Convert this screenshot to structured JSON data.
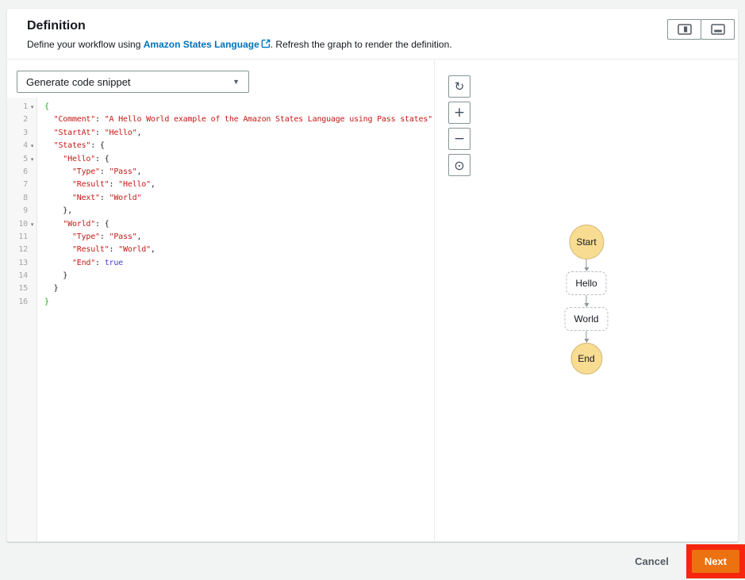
{
  "header": {
    "title": "Definition",
    "subtitle_prefix": "Define your workflow using ",
    "link_text": "Amazon States Language",
    "subtitle_suffix": ". Refresh the graph to render the definition."
  },
  "toolbar": {
    "snippet_dropdown_label": "Generate code snippet"
  },
  "editor": {
    "lines": [
      {
        "n": "1",
        "fold": true,
        "seg": [
          {
            "t": "{",
            "c": "green"
          }
        ]
      },
      {
        "n": "2",
        "fold": false,
        "seg": [
          {
            "t": "  ",
            "c": "pln"
          },
          {
            "t": "\"Comment\"",
            "c": "str"
          },
          {
            "t": ": ",
            "c": "pln"
          },
          {
            "t": "\"A Hello World example of the Amazon States Language using Pass states\"",
            "c": "str"
          },
          {
            "t": ",",
            "c": "pln"
          }
        ]
      },
      {
        "n": "3",
        "fold": false,
        "seg": [
          {
            "t": "  ",
            "c": "pln"
          },
          {
            "t": "\"StartAt\"",
            "c": "str"
          },
          {
            "t": ": ",
            "c": "pln"
          },
          {
            "t": "\"Hello\"",
            "c": "str"
          },
          {
            "t": ",",
            "c": "pln"
          }
        ]
      },
      {
        "n": "4",
        "fold": true,
        "seg": [
          {
            "t": "  ",
            "c": "pln"
          },
          {
            "t": "\"States\"",
            "c": "str"
          },
          {
            "t": ": {",
            "c": "pln"
          }
        ]
      },
      {
        "n": "5",
        "fold": true,
        "seg": [
          {
            "t": "    ",
            "c": "pln"
          },
          {
            "t": "\"Hello\"",
            "c": "str"
          },
          {
            "t": ": {",
            "c": "pln"
          }
        ]
      },
      {
        "n": "6",
        "fold": false,
        "seg": [
          {
            "t": "      ",
            "c": "pln"
          },
          {
            "t": "\"Type\"",
            "c": "str"
          },
          {
            "t": ": ",
            "c": "pln"
          },
          {
            "t": "\"Pass\"",
            "c": "str"
          },
          {
            "t": ",",
            "c": "pln"
          }
        ]
      },
      {
        "n": "7",
        "fold": false,
        "seg": [
          {
            "t": "      ",
            "c": "pln"
          },
          {
            "t": "\"Result\"",
            "c": "str"
          },
          {
            "t": ": ",
            "c": "pln"
          },
          {
            "t": "\"Hello\"",
            "c": "str"
          },
          {
            "t": ",",
            "c": "pln"
          }
        ]
      },
      {
        "n": "8",
        "fold": false,
        "seg": [
          {
            "t": "      ",
            "c": "pln"
          },
          {
            "t": "\"Next\"",
            "c": "str"
          },
          {
            "t": ": ",
            "c": "pln"
          },
          {
            "t": "\"World\"",
            "c": "str"
          }
        ]
      },
      {
        "n": "9",
        "fold": false,
        "seg": [
          {
            "t": "    },",
            "c": "pln"
          }
        ]
      },
      {
        "n": "10",
        "fold": true,
        "seg": [
          {
            "t": "    ",
            "c": "pln"
          },
          {
            "t": "\"World\"",
            "c": "str"
          },
          {
            "t": ": {",
            "c": "pln"
          }
        ]
      },
      {
        "n": "11",
        "fold": false,
        "seg": [
          {
            "t": "      ",
            "c": "pln"
          },
          {
            "t": "\"Type\"",
            "c": "str"
          },
          {
            "t": ": ",
            "c": "pln"
          },
          {
            "t": "\"Pass\"",
            "c": "str"
          },
          {
            "t": ",",
            "c": "pln"
          }
        ]
      },
      {
        "n": "12",
        "fold": false,
        "seg": [
          {
            "t": "      ",
            "c": "pln"
          },
          {
            "t": "\"Result\"",
            "c": "str"
          },
          {
            "t": ": ",
            "c": "pln"
          },
          {
            "t": "\"World\"",
            "c": "str"
          },
          {
            "t": ",",
            "c": "pln"
          }
        ]
      },
      {
        "n": "13",
        "fold": false,
        "seg": [
          {
            "t": "      ",
            "c": "pln"
          },
          {
            "t": "\"End\"",
            "c": "str"
          },
          {
            "t": ": ",
            "c": "pln"
          },
          {
            "t": "true",
            "c": "kw"
          }
        ]
      },
      {
        "n": "14",
        "fold": false,
        "seg": [
          {
            "t": "    }",
            "c": "pln"
          }
        ]
      },
      {
        "n": "15",
        "fold": false,
        "seg": [
          {
            "t": "  }",
            "c": "pln"
          }
        ]
      },
      {
        "n": "16",
        "fold": false,
        "seg": [
          {
            "t": "}",
            "c": "green"
          }
        ]
      }
    ]
  },
  "graph": {
    "controls": [
      {
        "name": "refresh",
        "glyph": "↻"
      },
      {
        "name": "zoom-in",
        "glyph": "+"
      },
      {
        "name": "zoom-out",
        "glyph": "−"
      },
      {
        "name": "center",
        "glyph": "⊙"
      }
    ],
    "nodes": {
      "start": "Start",
      "state1": "Hello",
      "state2": "World",
      "end": "End"
    }
  },
  "footer": {
    "cancel": "Cancel",
    "next": "Next"
  },
  "colors": {
    "accent_orange": "#ec7211",
    "annotation_red": "#f6260e",
    "link_blue": "#0073bb",
    "node_yellow": "#f8dc91",
    "code_string": "#c41a16",
    "code_keyword": "#4643d3",
    "code_brace_match": "#00b400"
  }
}
